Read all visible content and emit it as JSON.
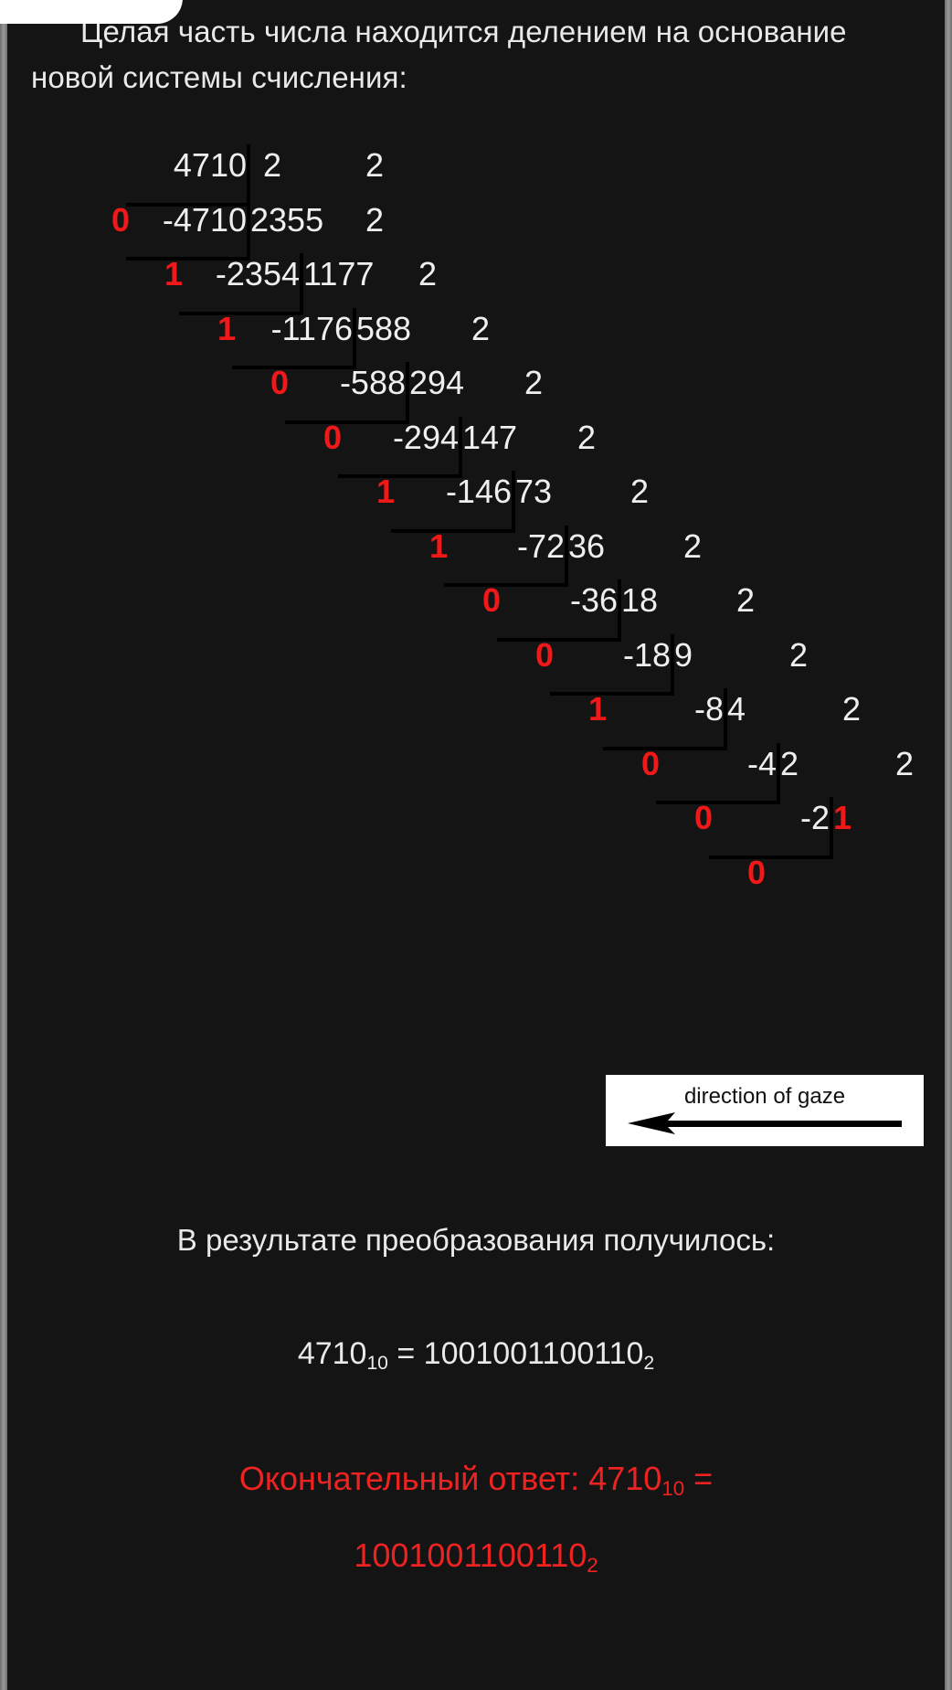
{
  "colors": {
    "background": "#141414",
    "text": "#e9e9e9",
    "remainder_red": "#f01818",
    "answer_red": "#ef2222",
    "rule_black": "#000000",
    "gaze_box_bg": "#ffffff",
    "scrollbar": "#8f8f8f"
  },
  "intro": {
    "text": "Целая часть числа находится делением на основание новой системы счисления:"
  },
  "division": {
    "number": "4710",
    "base": "2",
    "rows": [
      {
        "remainder": "",
        "subtrahend": "4710",
        "quotient": "4710",
        "divisor": "2",
        "first": true
      },
      {
        "remainder": "0",
        "subtrahend": "-4710",
        "quotient": "2355",
        "divisor": "2"
      },
      {
        "remainder": "1",
        "subtrahend": "-2354",
        "quotient": "1177",
        "divisor": "2"
      },
      {
        "remainder": "1",
        "subtrahend": "-1176",
        "quotient": "588",
        "divisor": "2"
      },
      {
        "remainder": "0",
        "subtrahend": "-588",
        "quotient": "294",
        "divisor": "2"
      },
      {
        "remainder": "0",
        "subtrahend": "-294",
        "quotient": "147",
        "divisor": "2"
      },
      {
        "remainder": "1",
        "subtrahend": "-146",
        "quotient": "73",
        "divisor": "2"
      },
      {
        "remainder": "1",
        "subtrahend": "-72",
        "quotient": "36",
        "divisor": "2"
      },
      {
        "remainder": "0",
        "subtrahend": "-36",
        "quotient": "18",
        "divisor": "2"
      },
      {
        "remainder": "0",
        "subtrahend": "-18",
        "quotient": "9",
        "divisor": "2"
      },
      {
        "remainder": "1",
        "subtrahend": "-8",
        "quotient": "4",
        "divisor": "2"
      },
      {
        "remainder": "0",
        "subtrahend": "-4",
        "quotient": "2",
        "divisor": "2"
      },
      {
        "remainder": "0",
        "subtrahend": "-2",
        "quotient": "1",
        "divisor": "",
        "quotient_red": true
      },
      {
        "remainder": "0",
        "subtrahend": "",
        "quotient": "",
        "divisor": "",
        "last": true
      }
    ]
  },
  "gaze": {
    "label": "direction of gaze",
    "arrow_direction": "left"
  },
  "result": {
    "intro": "В результате преобразования получилось:",
    "equation_decimal": "4710",
    "equation_decimal_sub": "10",
    "equals": "=",
    "equation_binary": "1001001100110",
    "equation_binary_sub": "2"
  },
  "final_answer": {
    "label": "Окончательный ответ:",
    "decimal": "4710",
    "decimal_sub": "10",
    "equals": "=",
    "binary": "1001001100110",
    "binary_sub": "2"
  }
}
